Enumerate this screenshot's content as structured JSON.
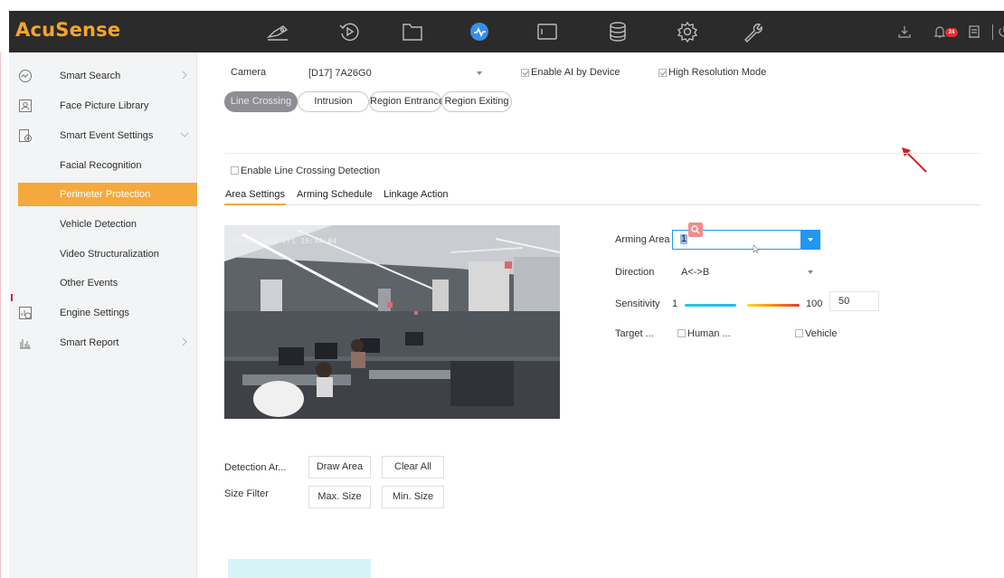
{
  "app": {
    "logo": "AcuSense"
  },
  "topnav": {
    "icons": [
      "live-view-icon",
      "playback-icon",
      "files-icon",
      "smart-analysis-icon",
      "window-icon",
      "storage-icon",
      "configuration-icon",
      "maintenance-icon"
    ],
    "right_icons": [
      "download-icon",
      "alarm-bell-icon",
      "notepad-icon",
      "power-icon"
    ],
    "alarm_count": "24"
  },
  "sidebar": {
    "items": [
      {
        "label": "Smart Search",
        "icon": "smart-search-icon",
        "arrow": "chevron-right"
      },
      {
        "label": "Face Picture Library",
        "icon": "face-library-icon"
      },
      {
        "label": "Smart Event Settings",
        "icon": "event-settings-icon",
        "arrow": "chevron-down"
      },
      {
        "label": "Facial Recognition"
      },
      {
        "label": "Perimeter Protection",
        "active": true
      },
      {
        "label": "Vehicle Detection"
      },
      {
        "label": "Video Structuralization"
      },
      {
        "label": "Other Events"
      },
      {
        "label": "Engine Settings",
        "icon": "engine-settings-icon"
      },
      {
        "label": "Smart Report",
        "icon": "smart-report-icon",
        "arrow": "chevron-right"
      }
    ]
  },
  "camera": {
    "label": "Camera",
    "value": "[D17] 7A26G0",
    "enable_ai_label": "Enable AI by Device",
    "enable_ai_checked": true,
    "high_res_label": "High Resolution Mode",
    "high_res_checked": true
  },
  "event_tabs": [
    {
      "label": "Line Crossing",
      "active": true
    },
    {
      "label": "Intrusion"
    },
    {
      "label": "Region Entrance"
    },
    {
      "label": "Region Exiting"
    }
  ],
  "enable_detection": {
    "label": "Enable Line Crossing Detection",
    "checked": false
  },
  "sub_tabs": [
    {
      "label": "Area Settings",
      "active": true
    },
    {
      "label": "Arming Schedule"
    },
    {
      "label": "Linkage Action"
    }
  ],
  "video": {
    "timestamp": "03-04-2020 Fri 16:44:04"
  },
  "settings": {
    "arming_area_label": "Arming Area",
    "arming_area_value": "1",
    "direction_label": "Direction",
    "direction_value": "A<->B",
    "sensitivity_label": "Sensitivity",
    "sensitivity_min": "1",
    "sensitivity_max": "100",
    "sensitivity_value": "50",
    "target_label": "Target ...",
    "target_human_label": "Human ...",
    "target_vehicle_label": "Vehicle",
    "target_human_checked": false,
    "target_vehicle_checked": false
  },
  "detection": {
    "area_label": "Detection Ar...",
    "draw_area": "Draw Area",
    "clear_all": "Clear All",
    "size_filter_label": "Size Filter",
    "max_size": "Max. Size",
    "min_size": "Min. Size"
  },
  "colors": {
    "accent": "#f5a93c",
    "topbar": "#2b2b2b",
    "logo": "#f4a62a",
    "selection": "#2196f3",
    "annotation": "#d62020"
  }
}
